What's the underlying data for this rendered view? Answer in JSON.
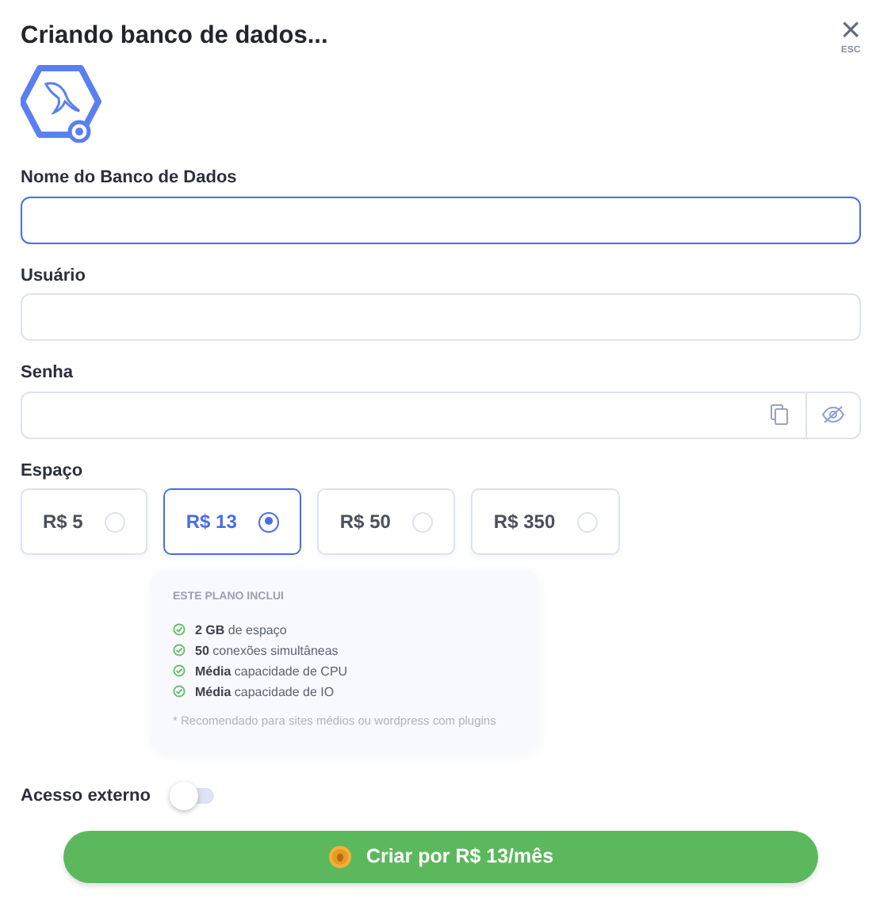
{
  "title": "Criando banco de dados...",
  "close": {
    "symbol": "×",
    "hint": "ESC"
  },
  "fields": [
    {
      "label": "Nome do Banco de Dados",
      "focused": true,
      "kind": "text"
    },
    {
      "label": "Usuário",
      "focused": false,
      "kind": "text"
    },
    {
      "label": "Senha",
      "focused": false,
      "kind": "password"
    }
  ],
  "space": {
    "label": "Espaço",
    "plans": [
      {
        "price": "R$ 5",
        "selected": false
      },
      {
        "price": "R$ 13",
        "selected": true
      },
      {
        "price": "R$ 50",
        "selected": false
      },
      {
        "price": "R$ 350",
        "selected": false
      }
    ],
    "includes": {
      "heading": "ESTE PLANO INCLUI",
      "features": [
        "**2 GB** de espaço",
        "**50** conexões simultâneas",
        "**Média** capacidade de CPU",
        "**Média** capacidade de IO"
      ],
      "note": "* Recomendado para sites médios ou wordpress com plugins"
    }
  },
  "external_access": {
    "label": "Acesso externo",
    "on": false
  },
  "submit": "Criar por R$ 13/mês"
}
